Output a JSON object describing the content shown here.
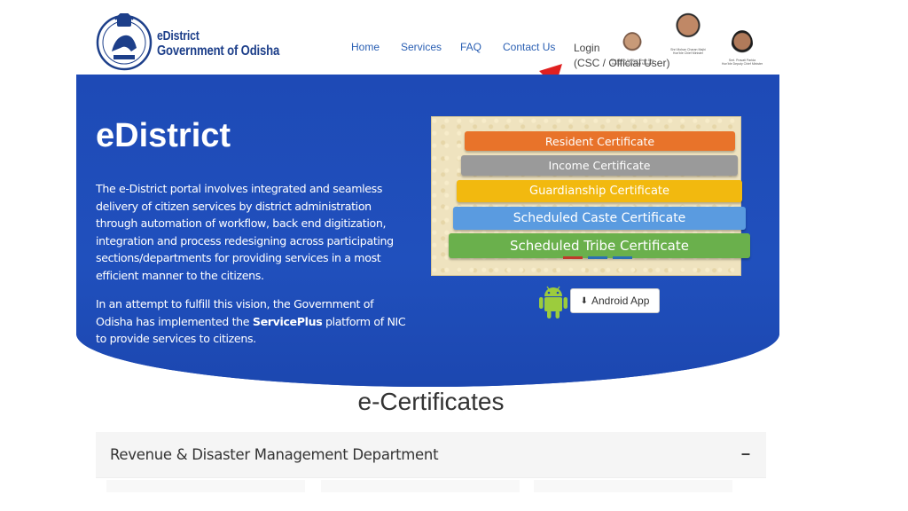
{
  "brand": {
    "line1": "eDistrict",
    "line2": "Government of Odisha"
  },
  "nav": {
    "items": [
      "Home",
      "Services",
      "FAQ",
      "Contact Us"
    ],
    "login_label": "Login",
    "login_sub": "(CSC / Official User)"
  },
  "leaders": [
    {
      "name": "Shri Kanak Vardhan Singh Deo",
      "role": "Hon'ble Deputy Chief Minister"
    },
    {
      "name": "Shri Mohan Charan Majhi",
      "role": "Hon'ble Chief Minister"
    },
    {
      "name": "Smt. Pravati Parida",
      "role": "Hon'ble Deputy Chief Minister"
    }
  ],
  "hero": {
    "title": "eDistrict",
    "paragraph1": "The e-District portal involves integrated and seamless delivery of citizen services by district administration through automation of workflow, back end digitization, integration and process redesigning across participating sections/departments for providing services in a most efficient manner to the citizens.",
    "paragraph2_pre": "In an attempt to fulfill this vision, the Government of Odisha has implemented the ",
    "paragraph2_bold": "ServicePlus",
    "paragraph2_post": " platform of NIC to provide services to citizens."
  },
  "slider": {
    "certificates": [
      {
        "label": "Resident Certificate",
        "color": "#e8732a"
      },
      {
        "label": "Income Certificate",
        "color": "#9a9a9a"
      },
      {
        "label": "Guardianship Certificate",
        "color": "#f2b90f"
      },
      {
        "label": "Scheduled Caste Certificate",
        "color": "#5a9be0"
      },
      {
        "label": "Scheduled Tribe Certificate",
        "color": "#6ab04c"
      }
    ]
  },
  "app": {
    "button_label": "Android App"
  },
  "section": {
    "title": "e-Certificates"
  },
  "accordion": {
    "label": "Revenue & Disaster Management Department",
    "toggle": "–"
  },
  "colors": {
    "hero_blue": "#1f4bb8",
    "nav_link": "#2a5fb3",
    "arrow_red": "#e02020",
    "android_green": "#9ccc3d"
  }
}
